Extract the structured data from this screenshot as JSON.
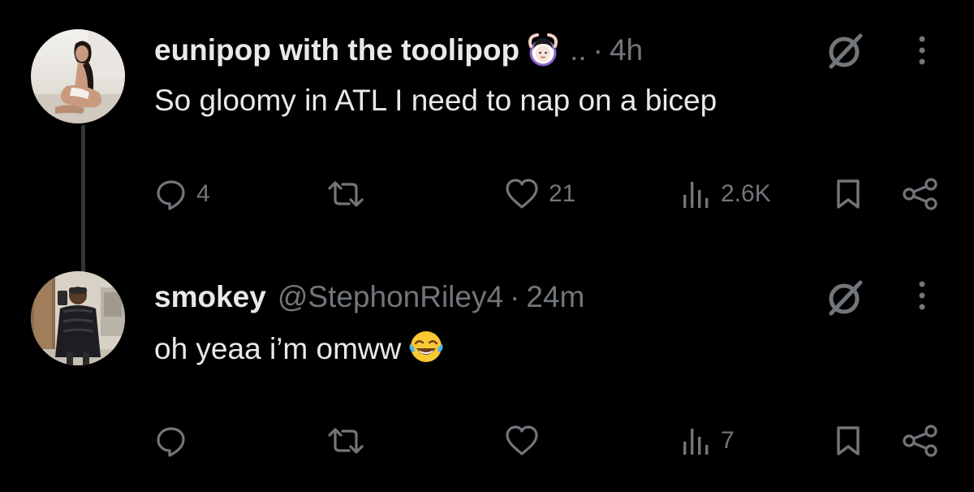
{
  "colors": {
    "background": "#000000",
    "primary_text": "#e7e9ea",
    "secondary_text": "#71767b",
    "thread_line": "#333639"
  },
  "tweets": [
    {
      "display_name": "eunipop with the toolipop",
      "name_emoji": "person-gesturing-ok-emoji",
      "truncation": "..",
      "separator": "·",
      "time": "4h",
      "text": "So gloomy in ATL I need to nap on a bicep",
      "avatar": "profile-photo",
      "actions": {
        "reply_count": "4",
        "retweet_count": "",
        "like_count": "21",
        "view_count": "2.6K"
      }
    },
    {
      "display_name": "smokey",
      "handle": "@StephonRiley4",
      "separator": "·",
      "time": "24m",
      "text": "oh yeaa i’m omww",
      "text_emoji": "face-with-tears-of-joy-emoji",
      "avatar": "profile-photo",
      "actions": {
        "reply_count": "",
        "retweet_count": "",
        "like_count": "",
        "view_count": "7"
      }
    }
  ],
  "icons": {
    "reply": "reply-icon",
    "retweet": "retweet-icon",
    "like": "heart-icon",
    "views": "views-icon",
    "bookmark": "bookmark-icon",
    "share": "share-icon",
    "grok": "grok-icon",
    "more": "more-icon"
  }
}
